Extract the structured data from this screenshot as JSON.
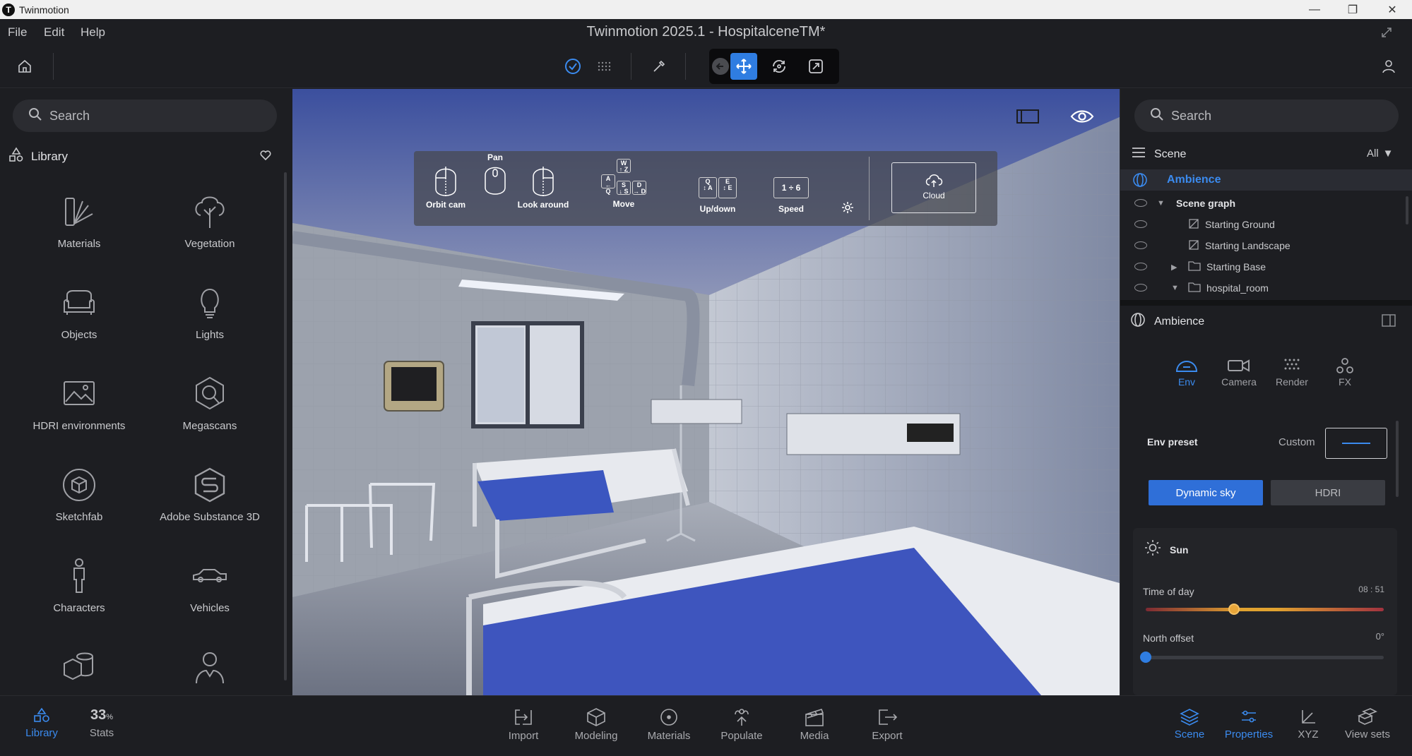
{
  "window": {
    "app_name": "Twinmotion",
    "logo_letter": "T",
    "controls": [
      "—",
      "❐",
      "✕"
    ]
  },
  "menubar": {
    "items": [
      "File",
      "Edit",
      "Help"
    ],
    "document_title": "Twinmotion 2025.1 - HospitalceneTM*"
  },
  "left_panel": {
    "search_placeholder": "Search",
    "section_title": "Library",
    "items": [
      {
        "label": "Materials",
        "icon": "material-swatch-icon"
      },
      {
        "label": "Vegetation",
        "icon": "tree-icon"
      },
      {
        "label": "Objects",
        "icon": "sofa-icon"
      },
      {
        "label": "Lights",
        "icon": "lightbulb-icon"
      },
      {
        "label": "HDRI environments",
        "icon": "hdri-icon"
      },
      {
        "label": "Megascans",
        "icon": "megascans-icon"
      },
      {
        "label": "Sketchfab",
        "icon": "sketchfab-icon"
      },
      {
        "label": "Adobe Substance 3D",
        "icon": "substance-icon"
      },
      {
        "label": "Characters",
        "icon": "person-icon"
      },
      {
        "label": "Vehicles",
        "icon": "car-icon"
      }
    ]
  },
  "viewport": {
    "nav_help": {
      "orbit_label": "Orbit cam",
      "pan_label": "Pan",
      "look_label": "Look around",
      "move_label": "Move",
      "updown_label": "Up/down",
      "speed_label": "Speed",
      "speed_keys": "1 ÷ 6",
      "cloud_label": "Cloud",
      "keys": {
        "w": "W",
        "w_sub": "↑ Z",
        "a": "A",
        "a_sub": "← Q",
        "s": "S",
        "s_sub": "↓ S",
        "d": "D",
        "d_sub": "→ D",
        "q": "Q",
        "q_sub": "↕ A",
        "e": "E",
        "e_sub": "↕ E"
      }
    }
  },
  "right_panel": {
    "search_placeholder": "Search",
    "scene_title": "Scene",
    "scene_filter": "All",
    "tree": [
      {
        "label": "Ambience",
        "level": 0,
        "selected": true
      },
      {
        "label": "Scene graph",
        "level": 1,
        "expander": "▼"
      },
      {
        "label": "Starting Ground",
        "level": 2
      },
      {
        "label": "Starting Landscape",
        "level": 2
      },
      {
        "label": "Starting Base",
        "level": 2,
        "expander": "▶"
      },
      {
        "label": "hospital_room",
        "level": 2,
        "expander": "▼"
      }
    ],
    "props_title": "Ambience",
    "tabs": [
      {
        "label": "Env",
        "active": true
      },
      {
        "label": "Camera",
        "active": false
      },
      {
        "label": "Render",
        "active": false
      },
      {
        "label": "FX",
        "active": false
      }
    ],
    "env_preset_label": "Env preset",
    "env_preset_value": "Custom",
    "sky_buttons": [
      "Dynamic sky",
      "HDRI"
    ],
    "sun_title": "Sun",
    "time_of_day_label": "Time of day",
    "time_of_day_value": "08 : 51",
    "time_of_day_fraction": 0.37,
    "north_offset_label": "North offset",
    "north_offset_value": "0°",
    "north_offset_fraction": 0.0
  },
  "bottombar": {
    "left": [
      {
        "label": "Library",
        "active": true
      },
      {
        "label": "Stats",
        "value": "33",
        "unit": "%"
      }
    ],
    "center": [
      "Import",
      "Modeling",
      "Materials",
      "Populate",
      "Media",
      "Export"
    ],
    "right": [
      {
        "label": "Scene",
        "active": true
      },
      {
        "label": "Properties",
        "active": true
      },
      {
        "label": "XYZ",
        "active": false
      },
      {
        "label": "View sets",
        "active": false
      }
    ]
  },
  "colors": {
    "accent": "#2f7de1",
    "panel_bg": "#1d1e22",
    "active_text": "#3b8bef"
  }
}
